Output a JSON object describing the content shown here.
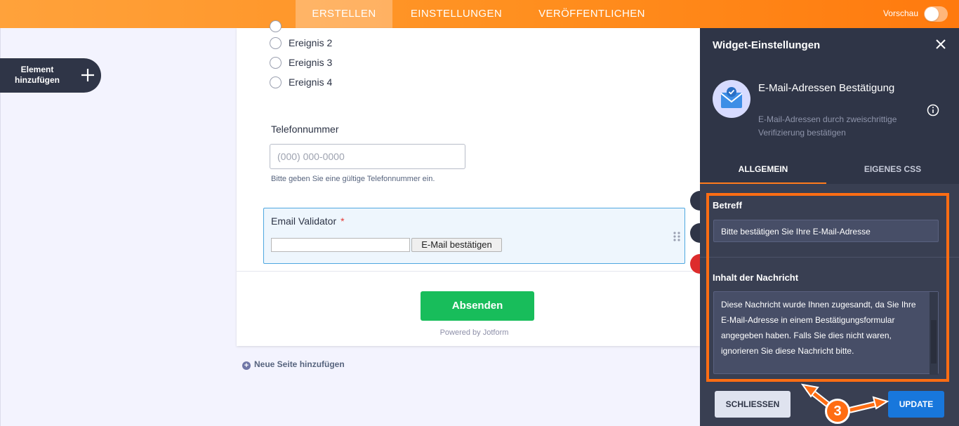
{
  "topbar": {
    "tabs": [
      {
        "label": "ERSTELLEN",
        "active": true
      },
      {
        "label": "EINSTELLUNGEN",
        "active": false
      },
      {
        "label": "VERÖFFENTLICHEN",
        "active": false
      }
    ],
    "preview_label": "Vorschau",
    "accent_color": "#ff8f1f"
  },
  "sidebar": {
    "add_element_label": "Element hinzufügen"
  },
  "form": {
    "radio_options": [
      "Ereignis 2",
      "Ereignis 3",
      "Ereignis 4"
    ],
    "phone": {
      "label": "Telefonnummer",
      "placeholder": "(000) 000-0000",
      "hint": "Bitte geben Sie eine gültige Telefonnummer ein."
    },
    "email_validator": {
      "label": "Email Validator",
      "required_mark": "*",
      "button_label": "E-Mail bestätigen"
    },
    "submit_label": "Absenden",
    "powered_by": "Powered by Jotform"
  },
  "add_page_label": "Neue Seite hinzufügen",
  "panel": {
    "title": "Widget-Einstellungen",
    "widget": {
      "name": "E-Mail-Adressen Bestätigung",
      "description": "E-Mail-Adressen durch zweischrittige Verifizierung bestätigen"
    },
    "tabs": [
      {
        "label": "ALLGEMEIN",
        "active": true
      },
      {
        "label": "EIGENES CSS",
        "active": false
      }
    ],
    "subject": {
      "label": "Betreff",
      "value": "Bitte bestätigen Sie Ihre E-Mail-Adresse"
    },
    "message": {
      "label": "Inhalt der Nachricht",
      "value": "Diese Nachricht wurde Ihnen zugesandt, da Sie Ihre E-Mail-Adresse in einem Bestätigungsformular angegeben haben. Falls Sie dies nicht waren, ignorieren Sie diese Nachricht bitte."
    },
    "close_button": "SCHLIESSEN",
    "update_button": "UPDATE"
  },
  "annotation": {
    "step_number": "3",
    "color": "#ff6d13"
  }
}
